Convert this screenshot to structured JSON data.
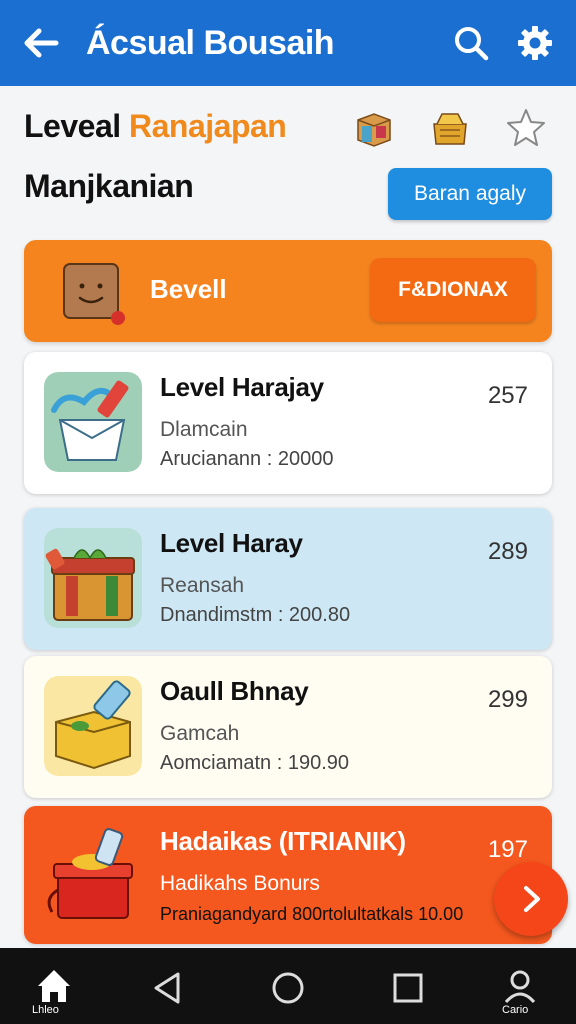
{
  "app": {
    "title": "Ácsual Bousaih"
  },
  "header": {
    "line1_main": "Leveal ",
    "line1_accent": "Ranajapan",
    "line2": "Manjkanian",
    "action_label": "Baran agaly"
  },
  "banner": {
    "label": "Bevell",
    "button_label": "F&DIONAX"
  },
  "cards": [
    {
      "title": "Level Harajay",
      "score": "257",
      "subtitle": "Dlamcain",
      "meta": "Arucianann : 20000"
    },
    {
      "title": "Level Haray",
      "score": "289",
      "subtitle": "Reansah",
      "meta": "Dnandimstm : 200.80"
    },
    {
      "title": "Oaull Bhnay",
      "score": "299",
      "subtitle": "Gamcah",
      "meta": "Aomciamatn : 190.90"
    },
    {
      "title": "Hadaikas (ITRIANIK)",
      "score": "197",
      "subtitle": "Hadikahs Bonurs",
      "meta": "Praniagandyard 800rtolultatkals 10.00"
    }
  ],
  "nav": {
    "home_label": "Lhleo",
    "profile_label": "Cario"
  },
  "colors": {
    "primary": "#1a6fd1",
    "accent": "#f5841f",
    "hot": "#f4581e"
  }
}
